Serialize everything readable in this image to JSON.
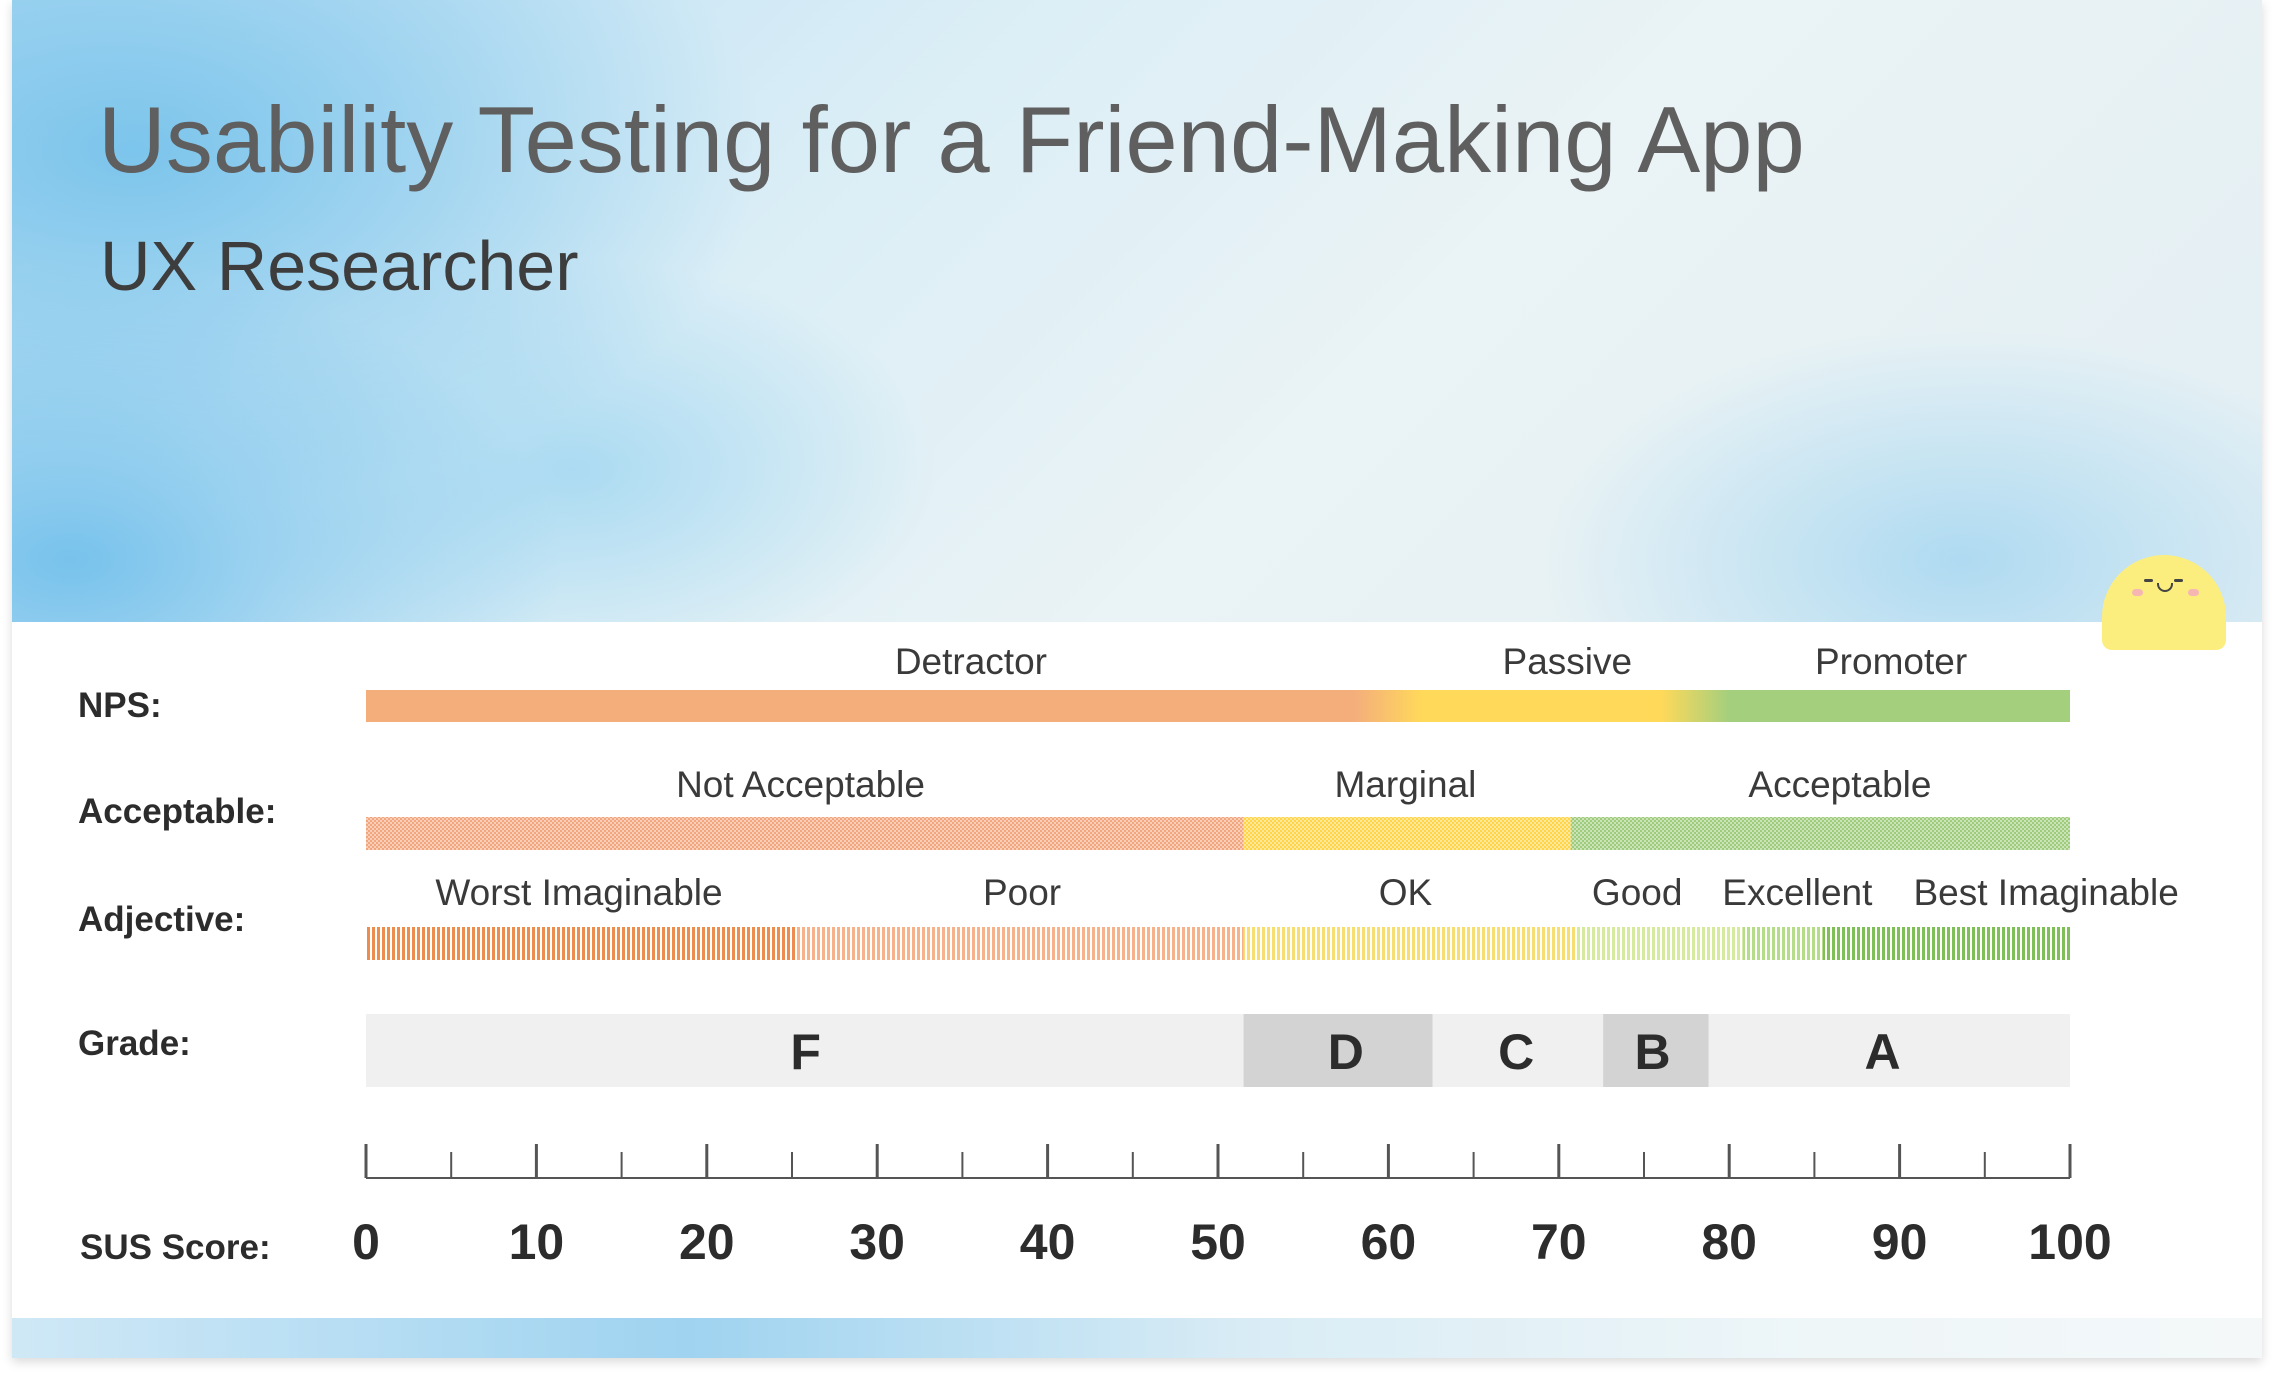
{
  "header": {
    "title": "Usability Testing for a Friend-Making App",
    "subtitle": "UX Researcher"
  },
  "colors": {
    "detractor": "#f4ae7c",
    "passive": "#ffd95a",
    "promoter": "#a4cf7d",
    "not_acceptable": "#f1a67d",
    "marginal": "#ffd447",
    "acceptable": "#9fcc7c",
    "grade_light": "#f0f0f0",
    "grade_dark": "#d3d3d3"
  },
  "chart_data": {
    "type": "table",
    "scale_label": "SUS Score:",
    "xlim": [
      0,
      100
    ],
    "ticks": [
      0,
      10,
      20,
      30,
      40,
      50,
      60,
      70,
      80,
      90,
      100
    ],
    "minor_tick_step": 5,
    "rows": [
      {
        "label": "NPS:",
        "style": "solid",
        "bands": [
          {
            "name": "Detractor",
            "start": 0,
            "end": 60,
            "color": "#f4ae7c",
            "label_at": 35.5
          },
          {
            "name": "Passive",
            "start": 60,
            "end": 78,
            "color": "#ffd95a",
            "label_at": 70.5
          },
          {
            "name": "Promoter",
            "start": 78,
            "end": 100,
            "color": "#a4cf7d",
            "label_at": 89.5
          }
        ]
      },
      {
        "label": "Acceptable:",
        "style": "dotted",
        "bands": [
          {
            "name": "Not Acceptable",
            "start": 0,
            "end": 51.5,
            "color": "#f1a67d",
            "label_at": 25.5
          },
          {
            "name": "Marginal",
            "start": 51.5,
            "end": 70.7,
            "color": "#ffd447",
            "label_at": 61
          },
          {
            "name": "Acceptable",
            "start": 70.7,
            "end": 100,
            "color": "#9fcc7c",
            "label_at": 86.5
          }
        ]
      },
      {
        "label": "Adjective:",
        "style": "striped",
        "bands": [
          {
            "name": "Worst Imaginable",
            "start": 0,
            "end": 25.2,
            "color": "#ec8d4f",
            "label_at": 12.5
          },
          {
            "name": "Poor",
            "start": 25.2,
            "end": 51.5,
            "color": "#f6b28a",
            "label_at": 38.5
          },
          {
            "name": "OK",
            "start": 51.5,
            "end": 71.1,
            "color": "#f7de72",
            "label_at": 61
          },
          {
            "name": "Good",
            "start": 71.1,
            "end": 80.8,
            "color": "#d5ea9e",
            "label_at": 74.6
          },
          {
            "name": "Excellent",
            "start": 80.8,
            "end": 85.5,
            "color": "#b5dc88",
            "label_at": 84
          },
          {
            "name": "Best Imaginable",
            "start": 85.5,
            "end": 100,
            "color": "#7fbf58",
            "label_at": 98.6
          }
        ]
      },
      {
        "label": "Grade:",
        "style": "block",
        "bands": [
          {
            "name": "F",
            "start": 0,
            "end": 51.5,
            "color": "#f0f0f0",
            "label_at": 25.8
          },
          {
            "name": "D",
            "start": 51.5,
            "end": 62.6,
            "color": "#d3d3d3",
            "label_at": 57.5
          },
          {
            "name": "C",
            "start": 62.6,
            "end": 72.6,
            "color": "#f0f0f0",
            "label_at": 67.5
          },
          {
            "name": "B",
            "start": 72.6,
            "end": 78.8,
            "color": "#d3d3d3",
            "label_at": 75.5
          },
          {
            "name": "A",
            "start": 78.8,
            "end": 100,
            "color": "#f0f0f0",
            "label_at": 89
          }
        ]
      }
    ]
  }
}
